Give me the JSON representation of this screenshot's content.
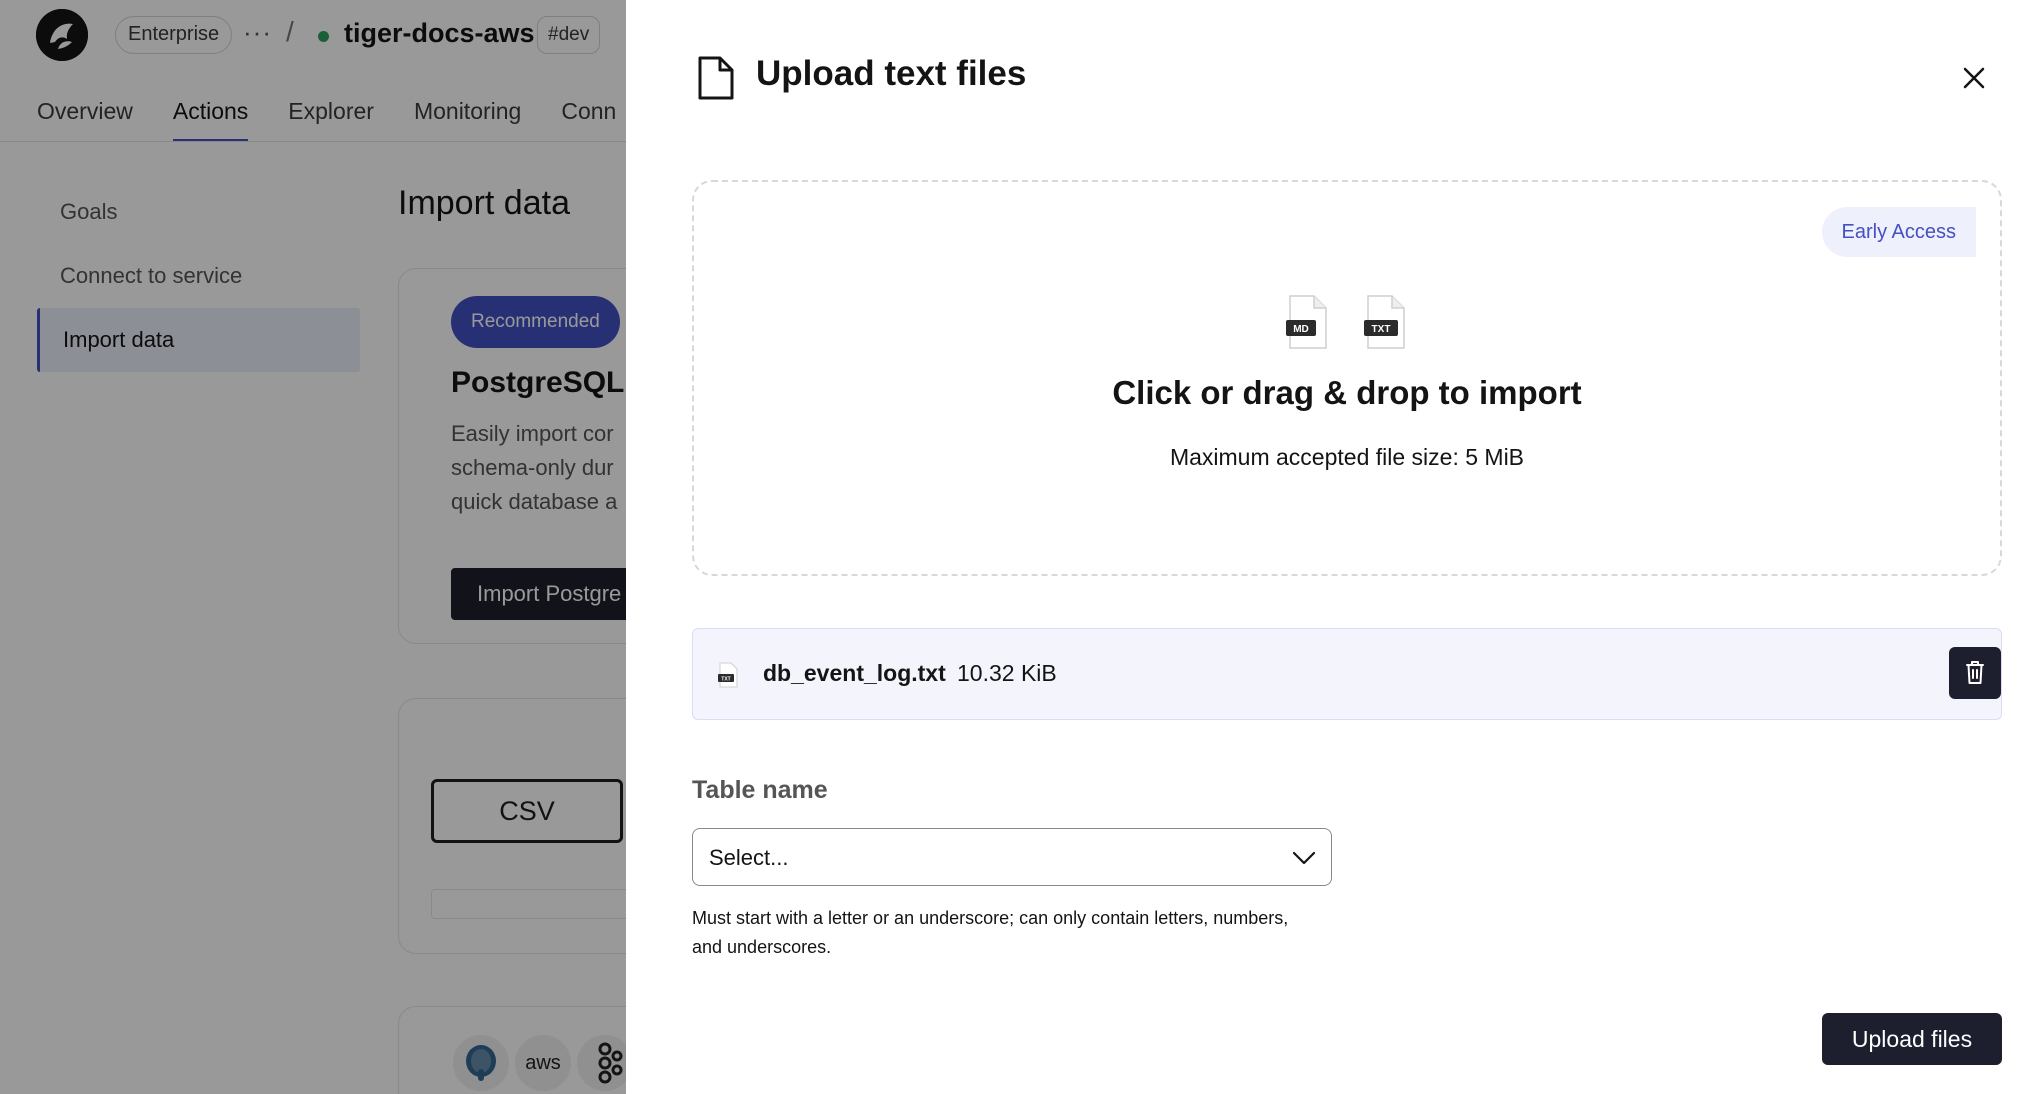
{
  "app": {
    "org_badge": "Enterprise",
    "more": "···",
    "separator": "/",
    "project_name": "tiger-docs-aws",
    "env_badge": "#dev",
    "tabs": [
      {
        "label": "Overview"
      },
      {
        "label": "Actions"
      },
      {
        "label": "Explorer"
      },
      {
        "label": "Monitoring"
      },
      {
        "label": "Conn"
      }
    ],
    "sidebar": {
      "items": [
        {
          "label": "Goals"
        },
        {
          "label": "Connect to service"
        },
        {
          "label": "Import data"
        }
      ]
    },
    "main": {
      "title": "Import data",
      "card1": {
        "badge": "Recommended",
        "title": "PostgreSQL I",
        "description_lines": [
          "Easily import cor",
          "schema-only dur",
          "quick database a"
        ],
        "button": "Import Postgre"
      },
      "card2": {
        "csv_button": "CSV"
      },
      "card3": {
        "icons": [
          "postgres-icon",
          "aws-icon",
          "kafka-icon"
        ],
        "aws_text": "aws"
      }
    }
  },
  "drawer": {
    "title": "Upload text files",
    "dropzone": {
      "badge": "Early Access",
      "file_types": [
        "MD",
        "TXT"
      ],
      "title": "Click or drag & drop to import",
      "subtitle": "Maximum accepted file size: 5 MiB"
    },
    "file": {
      "icon_type": "TXT",
      "name": "db_event_log.txt",
      "size": "10.32 KiB"
    },
    "table_label": "Table name",
    "select_placeholder": "Select...",
    "helper": "Must start with a letter or an underscore; can only contain letters, numbers, and underscores.",
    "upload_button": "Upload files"
  },
  "colors": {
    "accent": "#4450c4",
    "dark_button": "#1e1f2e",
    "status_green": "#2e9e5b"
  }
}
